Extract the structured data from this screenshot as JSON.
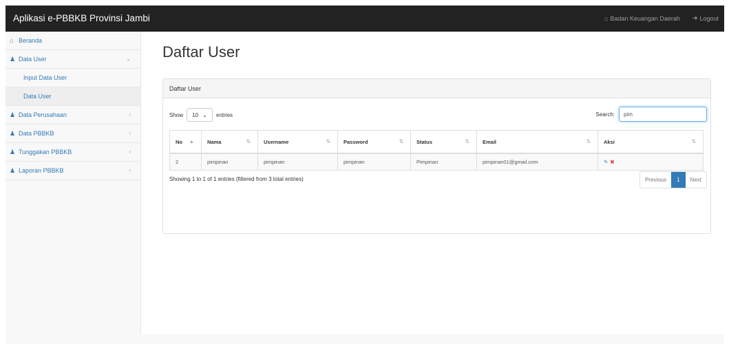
{
  "app": {
    "title": "Aplikasi e-PBBKB Provinsi Jambi"
  },
  "topnav": {
    "org_label": "Badan Keuangan Daerah",
    "logout_label": "Logout"
  },
  "sidebar": {
    "items": [
      {
        "label": "Beranda",
        "icon": "home-icon"
      },
      {
        "label": "Data User",
        "icon": "users-icon"
      },
      {
        "label": "Data Perusahaan",
        "icon": "users-icon"
      },
      {
        "label": "Data PBBKB",
        "icon": "users-icon"
      },
      {
        "label": "Tunggakan PBBKB",
        "icon": "users-icon"
      },
      {
        "label": "Laporan PBBKB",
        "icon": "users-icon"
      }
    ],
    "subitems": [
      {
        "label": "Input Data User"
      },
      {
        "label": "Data User"
      }
    ]
  },
  "page": {
    "title": "Daftar User"
  },
  "panel": {
    "heading": "Daftar User"
  },
  "table_controls": {
    "show_label": "Show",
    "entries_value": "10",
    "entries_label": "entries",
    "search_label": "Search:",
    "search_value": "pim"
  },
  "table": {
    "headers": [
      "No",
      "Nama",
      "Username",
      "Password",
      "Status",
      "Email",
      "Aksi"
    ],
    "rows": [
      [
        "2",
        "pimpinan",
        "pimpinan",
        "pimpinan",
        "Pimpinan",
        "pimpinan01@gmail.com"
      ]
    ]
  },
  "info": {
    "text": "Showing 1 to 1 of 1 entries (filtered from 3 total entries)"
  },
  "pagination": {
    "previous": "Previous",
    "current": "1",
    "next": "Next"
  },
  "colors": {
    "accent": "#337ab7",
    "navbar": "#222222",
    "danger": "#d9534f"
  }
}
